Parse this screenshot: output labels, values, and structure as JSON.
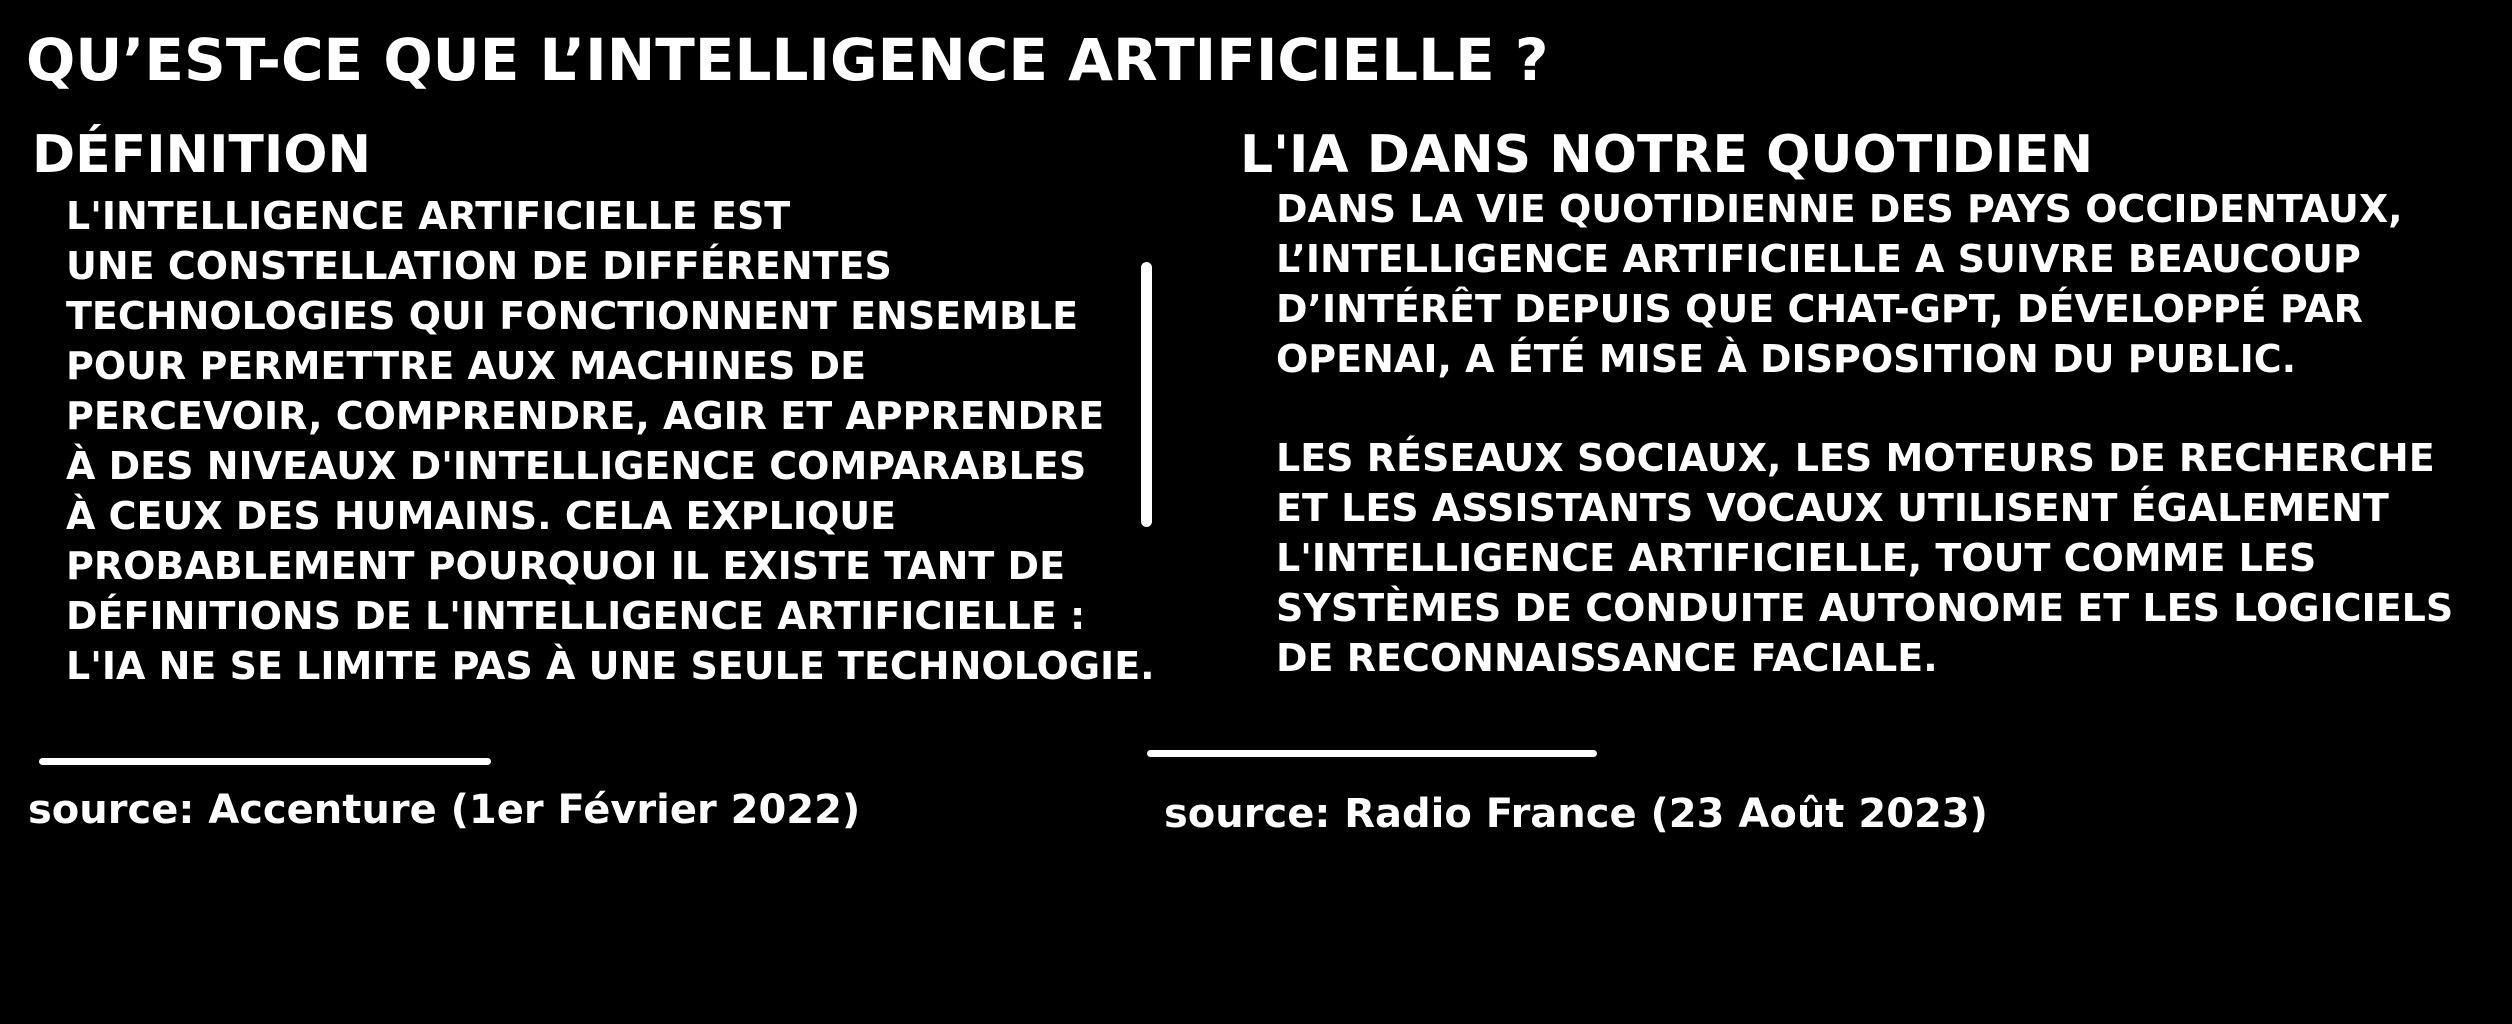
{
  "title": "QU’EST-CE QUE L’INTELLIGENCE ARTIFICIELLE ?",
  "left_section": {
    "heading": "DÉFINITION",
    "lines": [
      "L'INTELLIGENCE ARTIFICIELLE EST",
      "UNE CONSTELLATION DE DIFFÉRENTES",
      "TECHNOLOGIES QUI FONCTIONNENT ENSEMBLE",
      "POUR PERMETTRE AUX MACHINES DE",
      "PERCEVOIR, COMPRENDRE, AGIR ET APPRENDRE",
      "À DES NIVEAUX D'INTELLIGENCE COMPARABLES",
      "À CEUX DES HUMAINS. CELA EXPLIQUE",
      "PROBABLEMENT POURQUOI IL EXISTE TANT DE",
      "DÉFINITIONS DE L'INTELLIGENCE ARTIFICIELLE :",
      "L'IA NE SE LIMITE PAS À UNE SEULE TECHNOLOGIE."
    ],
    "source": "source: Accenture (1er Février 2022)"
  },
  "right_section": {
    "heading": "L'IA DANS NOTRE QUOTIDIEN",
    "paragraph_1": [
      "DANS LA VIE QUOTIDIENNE DES PAYS OCCIDENTAUX,",
      "L’INTELLIGENCE ARTIFICIELLE A SUIVRE BEAUCOUP",
      "D’INTÉRÊT DEPUIS QUE CHAT-GPT, DÉVELOPPÉ PAR",
      "OPENAI, A ÉTÉ MISE À DISPOSITION DU PUBLIC."
    ],
    "paragraph_2": [
      "LES RÉSEAUX SOCIAUX, LES MOTEURS DE RECHERCHE",
      "ET LES ASSISTANTS VOCAUX UTILISENT ÉGALEMENT",
      "L'INTELLIGENCE ARTIFICIELLE, TOUT COMME LES",
      "SYSTÈMES DE CONDUITE AUTONOME ET LES LOGICIELS",
      "DE RECONNAISSANCE FACIALE."
    ],
    "source": "source: Radio France (23 Août 2023)"
  },
  "colors": {
    "background": "#000000",
    "text": "#ffffff"
  }
}
